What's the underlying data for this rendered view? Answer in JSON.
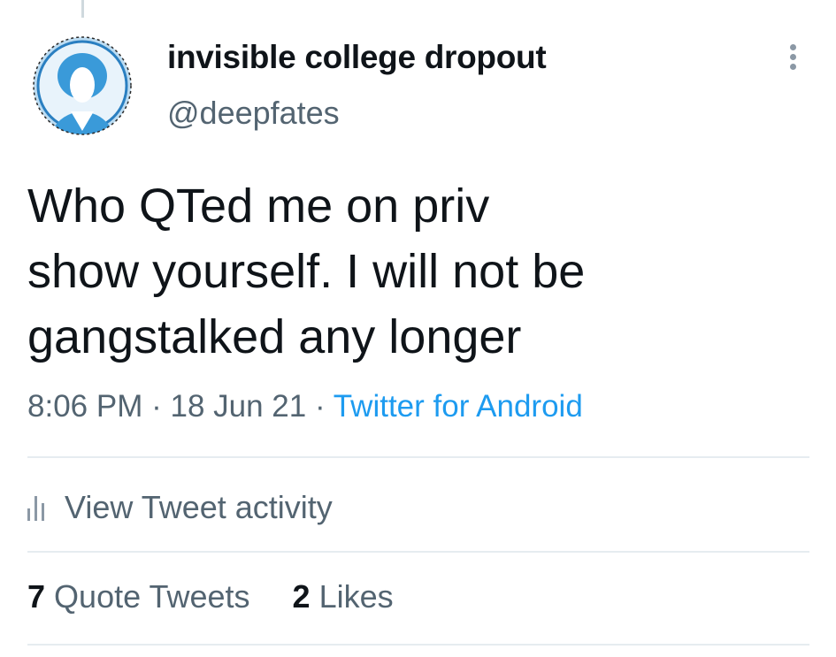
{
  "tweet": {
    "author": {
      "display_name": "invisible college dropout",
      "handle": "@deepfates",
      "avatar_icon": "avatar-icon"
    },
    "text_lines": [
      "Who QTed me on priv",
      "show yourself. I will not be",
      "gangstalked any longer"
    ],
    "time": "8:06 PM",
    "separator": "·",
    "date": "18 Jun 21",
    "source": "Twitter for Android",
    "more_icon": "more-vertical-icon"
  },
  "activity": {
    "icon": "bar-chart-icon",
    "label": "View Tweet activity"
  },
  "stats": {
    "quote_tweets_count": "7",
    "quote_tweets_label": "Quote Tweets",
    "likes_count": "2",
    "likes_label": "Likes"
  },
  "colors": {
    "text_primary": "#0f1419",
    "text_secondary": "#536471",
    "link": "#1d9bf0",
    "divider": "#e6ecf0",
    "avatar_blue": "#3a9ad9"
  }
}
